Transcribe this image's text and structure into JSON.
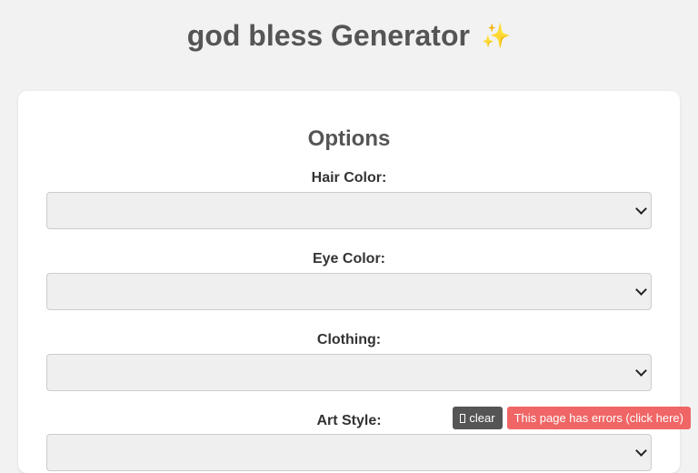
{
  "header": {
    "title": "god bless Generator",
    "title_icon": "sparkles-icon",
    "title_icon_glyph": "✨"
  },
  "options_panel": {
    "title": "Options",
    "fields": [
      {
        "label": "Hair Color:",
        "value": ""
      },
      {
        "label": "Eye Color:",
        "value": ""
      },
      {
        "label": "Clothing:",
        "value": ""
      },
      {
        "label": "Art Style:",
        "value": ""
      }
    ]
  },
  "debug_bar": {
    "clear_label": "clear",
    "clear_icon": "clipboard-icon",
    "error_label": "This page has errors (click here)"
  },
  "colors": {
    "background": "#f2f2f2",
    "card": "#ffffff",
    "select_background": "#efefef",
    "clear_button": "#555555",
    "error_button": "#f06565"
  }
}
